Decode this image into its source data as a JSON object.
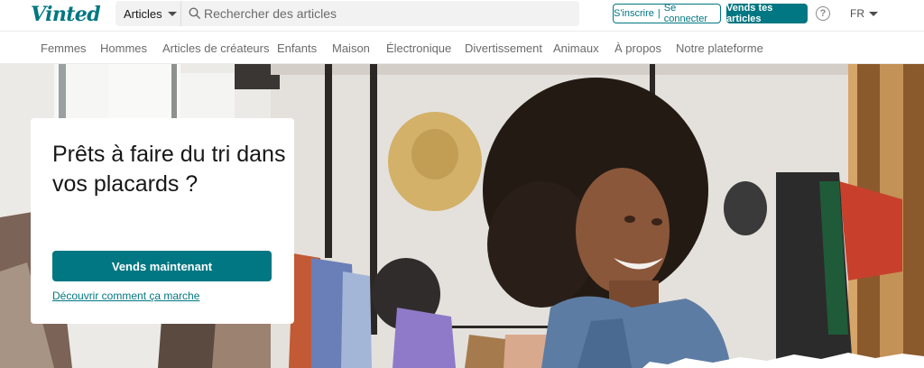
{
  "brand": {
    "logo_text": "Vinted",
    "accent_color": "#007782"
  },
  "header": {
    "category_select": "Articles",
    "search_placeholder": "Rechercher des articles",
    "signup_label": "S'inscrire",
    "login_label": "Se connecter",
    "sell_label": "Vends tes articles",
    "help_icon": "question-circle-icon",
    "language": "FR"
  },
  "nav": {
    "items": [
      {
        "label": "Femmes"
      },
      {
        "label": "Hommes"
      },
      {
        "label": "Articles de créateurs"
      },
      {
        "label": "Enfants"
      },
      {
        "label": "Maison"
      },
      {
        "label": "Électronique"
      },
      {
        "label": "Divertissement"
      },
      {
        "label": "Animaux"
      },
      {
        "label": "À propos"
      },
      {
        "label": "Notre plateforme"
      }
    ]
  },
  "hero": {
    "title": "Prêts à faire du tri dans vos placards ?",
    "cta_label": "Vends maintenant",
    "link_label": "Découvrir comment ça marche"
  }
}
